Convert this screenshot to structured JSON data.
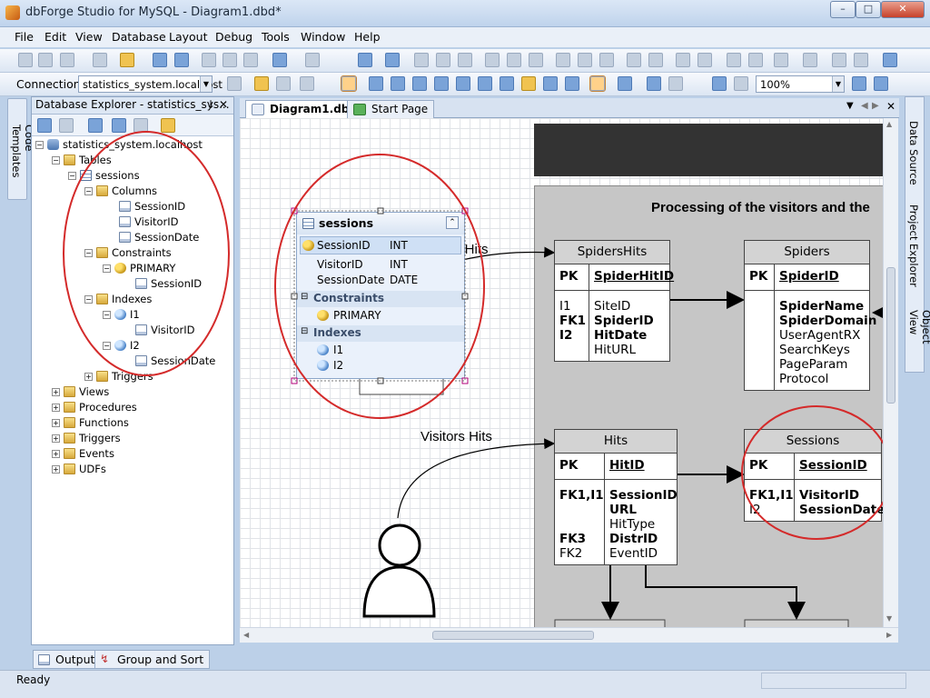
{
  "window": {
    "title": "dbForge Studio for MySQL - Diagram1.dbd*",
    "min": "–",
    "max": "□",
    "close": "✕"
  },
  "menu": [
    "File",
    "Edit",
    "View",
    "Database",
    "Layout",
    "Debug",
    "Tools",
    "Window",
    "Help"
  ],
  "toolbar": {
    "connection_label": "Connection",
    "connection_value": "statistics_system.localhost",
    "zoom_value": "100%"
  },
  "left_side_tab": "Code Templates",
  "explorer": {
    "title": "Database Explorer - statistics_sys...",
    "pin": "↓",
    "close": "✕",
    "root": "statistics_system.localhost",
    "tables": "Tables",
    "table": "sessions",
    "columns": "Columns",
    "col1": "SessionID",
    "col2": "VisitorID",
    "col3": "SessionDate",
    "constraints": "Constraints",
    "primary": "PRIMARY",
    "primary_col": "SessionID",
    "indexes": "Indexes",
    "i1": "I1",
    "i1_col": "VisitorID",
    "i2": "I2",
    "i2_col": "SessionDate",
    "triggers_inner": "Triggers",
    "views": "Views",
    "procedures": "Procedures",
    "functions": "Functions",
    "triggers": "Triggers",
    "events": "Events",
    "udfs": "UDFs"
  },
  "right_side_tabs": [
    "Data Source",
    "Project Explorer",
    "Object View"
  ],
  "doc_tabs": {
    "diagram": "Diagram1.dbd*",
    "start": "Start Page"
  },
  "sessions_box": {
    "title": "sessions",
    "col1_name": "SessionID",
    "col1_type": "INT",
    "col2_name": "VisitorID",
    "col2_type": "INT",
    "col3_name": "SessionDate",
    "col3_type": "DATE",
    "constraints": "Constraints",
    "primary": "PRIMARY",
    "indexes": "Indexes",
    "i1": "I1",
    "i2": "I2"
  },
  "diagram": {
    "heading": "Processing of the visitors and the",
    "label_spiders_hits_partial": "s Hits",
    "label_visitors_hits": "Visitors Hits",
    "spidershits": {
      "title": "SpidersHits",
      "pk": "PK",
      "pk_col": "SpiderHitID",
      "k1": "I1",
      "k2": "FK1",
      "k3": "I2",
      "c1": "SiteID",
      "c2": "SpiderID",
      "c3": "HitDate",
      "c4": "HitURL"
    },
    "spiders": {
      "title": "Spiders",
      "pk": "PK",
      "pk_col": "SpiderID",
      "c1": "SpiderName",
      "c2": "SpiderDomain",
      "c3": "UserAgentRX",
      "c4": "SearchKeys",
      "c5": "PageParam",
      "c6": "Protocol"
    },
    "hits": {
      "title": "Hits",
      "pk": "PK",
      "pk_col": "HitID",
      "k1": "FK1,I1",
      "k2": "FK3",
      "k3": "FK2",
      "c1": "SessionID",
      "c2": "URL",
      "c3": "HitType",
      "c4": "DistrID",
      "c5": "EventID"
    },
    "sessions": {
      "title": "Sessions",
      "pk": "PK",
      "pk_col": "SessionID",
      "k1": "FK1,I1",
      "k2": "I2",
      "c1": "VisitorID",
      "c2": "SessionDate"
    }
  },
  "bottom_tabs": {
    "output": "Output",
    "group": "Group and Sort"
  },
  "status": {
    "text": "Ready"
  },
  "colors": {
    "highlight_circle": "#d42a2a",
    "diagram_bg": "#c6c6c6",
    "header_bar": "#333333"
  }
}
